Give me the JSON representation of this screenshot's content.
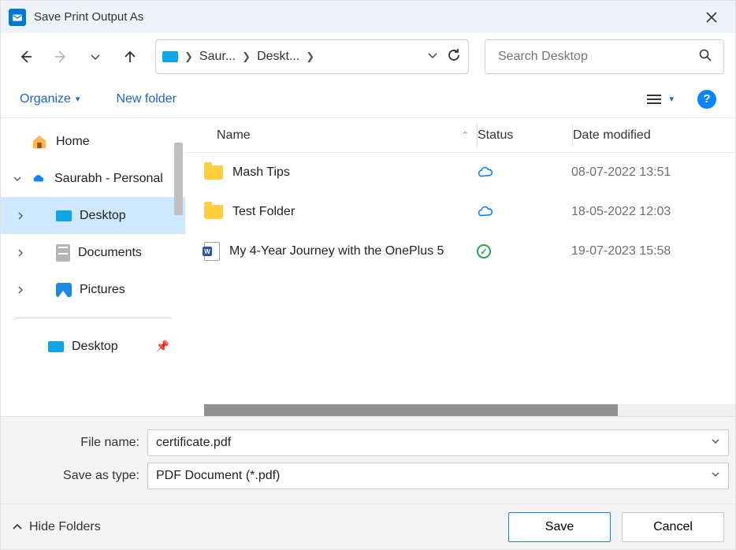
{
  "titlebar": {
    "title": "Save Print Output As"
  },
  "breadcrumb": {
    "seg1": "Saur...",
    "seg2": "Deskt..."
  },
  "search": {
    "placeholder": "Search Desktop"
  },
  "toolbar": {
    "organize": "Organize",
    "newfolder": "New folder"
  },
  "tree": {
    "home": "Home",
    "personal": "Saurabh - Personal",
    "desktop": "Desktop",
    "documents": "Documents",
    "pictures": "Pictures",
    "desktop_quick": "Desktop"
  },
  "columns": {
    "name": "Name",
    "status": "Status",
    "date": "Date modified"
  },
  "rows": [
    {
      "name": "Mash Tips",
      "date": "08-07-2022 13:51"
    },
    {
      "name": "Test Folder",
      "date": "18-05-2022 12:03"
    },
    {
      "name": "My 4-Year Journey with the OnePlus 5",
      "date": "19-07-2023 15:58"
    }
  ],
  "fields": {
    "filename_label": "File name:",
    "filename_value": "certificate.pdf",
    "type_label": "Save as type:",
    "type_value": "PDF Document (*.pdf)"
  },
  "bottom": {
    "hide": "Hide Folders",
    "save": "Save",
    "cancel": "Cancel"
  }
}
